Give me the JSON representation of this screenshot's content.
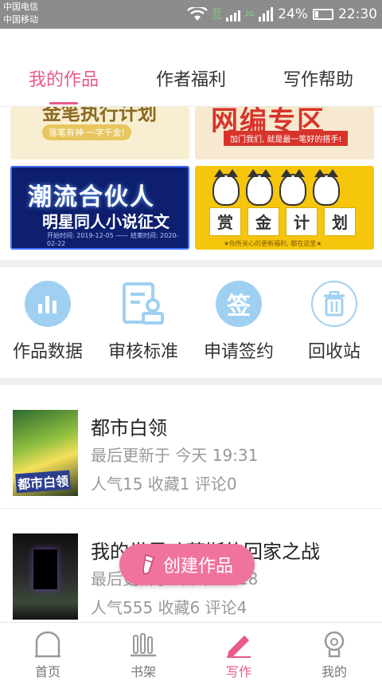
{
  "status_bar": {
    "carrier_1": "中国电信",
    "carrier_2": "中国移动",
    "net_1": "3G",
    "net_2": "2G",
    "net_3": "2G",
    "battery": "24%",
    "time": "22:30"
  },
  "tabs": [
    {
      "label": "我的作品",
      "active": true
    },
    {
      "label": "作者福利",
      "active": false
    },
    {
      "label": "写作帮助",
      "active": false
    }
  ],
  "banners": {
    "b1": {
      "title": "金笔执行计划",
      "sub": "落笔有神·一字千金!"
    },
    "b2": {
      "title": "网编专区",
      "sub": "加门我们, 就是最一笔好的搭手!"
    },
    "b3": {
      "title": "潮流合伙人",
      "sub": "明星同人小说征文",
      "dates": "开始时间: 2019-12-05 —— 结束时间: 2020-02-22"
    },
    "b4": {
      "chars": [
        "赏",
        "金",
        "计",
        "划"
      ],
      "note": "★你所关心的更新福利, 都在这里★"
    }
  },
  "quick_actions": [
    {
      "label": "作品数据",
      "icon": "bar-chart-icon"
    },
    {
      "label": "审核标准",
      "icon": "review-doc-icon"
    },
    {
      "label": "申请签约",
      "icon": "sign-contract-icon",
      "glyph": "签"
    },
    {
      "label": "回收站",
      "icon": "trash-icon"
    }
  ],
  "works": [
    {
      "title": "都市白领",
      "updated": "最后更新于 今天 19:31",
      "stats": "人气15 收藏1 评论0",
      "cover_text": "都市白领"
    },
    {
      "title": "我的世界叶蒂斯的回家之战",
      "updated": "最后更新于 今天 19:18",
      "stats": "人气555 收藏6 评论4"
    }
  ],
  "fab": {
    "label": "创建作品"
  },
  "bottom_nav": [
    {
      "label": "首页",
      "icon": "home-icon"
    },
    {
      "label": "书架",
      "icon": "bookshelf-icon"
    },
    {
      "label": "写作",
      "icon": "pen-icon",
      "active": true
    },
    {
      "label": "我的",
      "icon": "profile-icon"
    }
  ],
  "colors": {
    "accent": "#e85a87",
    "fab": "#f0739f",
    "icon_blue": "#9fd0f2"
  }
}
